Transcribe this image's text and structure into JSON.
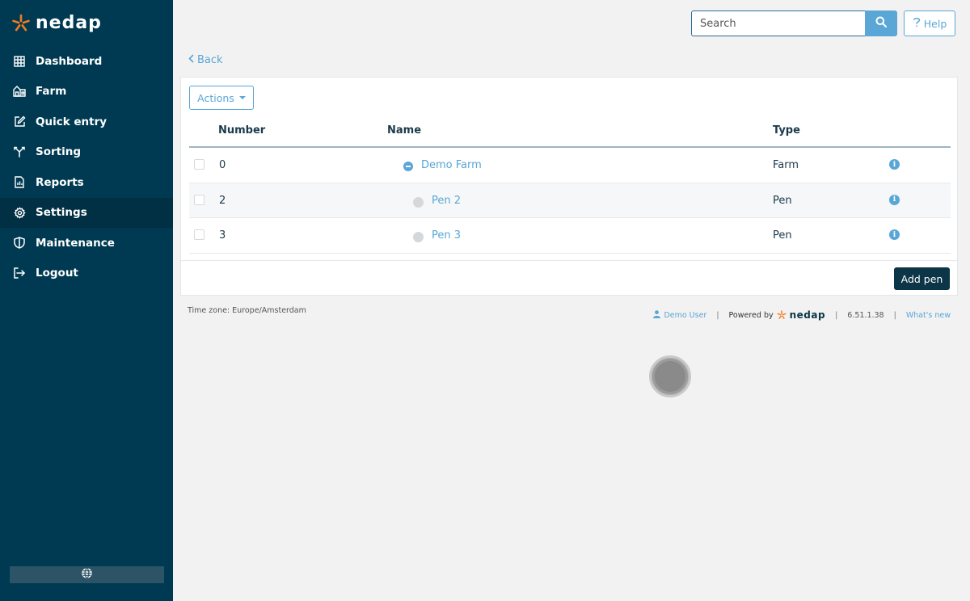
{
  "brand": {
    "name": "nedap",
    "accent": "#f47b20"
  },
  "sidebar": {
    "items": [
      {
        "label": "Dashboard",
        "icon": "grid-icon"
      },
      {
        "label": "Farm",
        "icon": "barn-icon"
      },
      {
        "label": "Quick entry",
        "icon": "edit-icon"
      },
      {
        "label": "Sorting",
        "icon": "sort-fork-icon"
      },
      {
        "label": "Reports",
        "icon": "report-icon"
      },
      {
        "label": "Settings",
        "icon": "gear-icon",
        "active": true
      },
      {
        "label": "Maintenance",
        "icon": "shield-icon"
      },
      {
        "label": "Logout",
        "icon": "logout-icon"
      }
    ],
    "language_icon": "globe-icon"
  },
  "header": {
    "search_placeholder": "Search",
    "help_label": "Help"
  },
  "nav": {
    "back_label": "Back"
  },
  "toolbar": {
    "actions_label": "Actions"
  },
  "table": {
    "columns": [
      "Number",
      "Name",
      "Type"
    ],
    "rows": [
      {
        "number": "0",
        "name": "Demo Farm",
        "type": "Farm",
        "level": 0,
        "expanded": true
      },
      {
        "number": "2",
        "name": "Pen 2",
        "type": "Pen",
        "level": 1
      },
      {
        "number": "3",
        "name": "Pen 3",
        "type": "Pen",
        "level": 1
      }
    ]
  },
  "footer_actions": {
    "add_label": "Add pen"
  },
  "footer": {
    "timezone": "Time zone: Europe/Amsterdam",
    "user": "Demo User",
    "powered_by": "Powered by",
    "brand": "nedap",
    "version": "6.51.1.38",
    "whats_new": "What's new",
    "separator": "|"
  },
  "colors": {
    "sidebar_bg": "#003a52",
    "link": "#5aa6d6",
    "primary_button": "#0c3547"
  }
}
